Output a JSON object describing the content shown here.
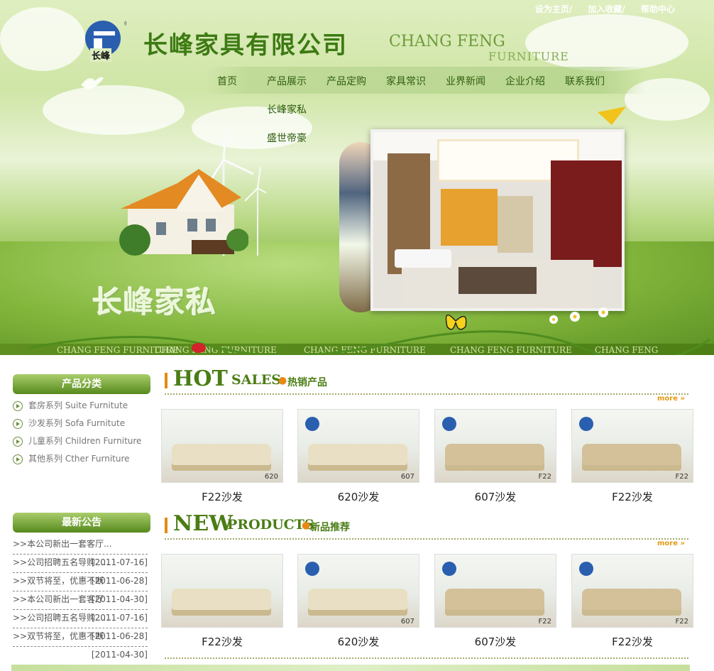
{
  "top_links": [
    "设为主页/",
    "加入收藏/",
    "帮助中心"
  ],
  "logo_text": "长峰",
  "company_name": "长峰家具有限公司",
  "english_name_1": "CHANG FENG",
  "english_name_2": "FURNITURE",
  "nav": [
    "首页",
    "产品展示",
    "产品定购",
    "家具常识",
    "业界新闻",
    "企业介绍",
    "联系我们"
  ],
  "nav_dropdown": [
    "长峰家私",
    "盛世帝豪"
  ],
  "banner_slogan": "长峰家私",
  "strip_texts": [
    "CHANG FENG FURNITURE",
    "CHANG FENG FURNITURE",
    "CHANG FENG FURNITURE",
    "CHANG FENG FURNITURE",
    "CHANG FENG FURNITURE"
  ],
  "categories": {
    "title": "产品分类",
    "items": [
      "套房系列 Suite Furnitute",
      "沙发系列 Sofa Furnitute",
      "儿童系列 Children Furniture",
      "其他系列 Cther Furniture"
    ]
  },
  "notices": {
    "title": "最新公告",
    "items": [
      {
        "text": ">>本公司新出一套客厅...",
        "date": ""
      },
      {
        "text": ">>公司招聘五名导购......",
        "date": "[2011-07-16]"
      },
      {
        "text": ">>双节将至，优惠不断",
        "date": "[2011-06-28]"
      },
      {
        "text": ">>本公司新出一套客厅",
        "date": "[2011-04-30]"
      },
      {
        "text": ">>公司招聘五名导购......",
        "date": "[2011-07-16]"
      },
      {
        "text": ">>双节将至，优惠不断",
        "date": "[2011-06-28]"
      },
      {
        "text": "",
        "date": "[2011-04-30]"
      }
    ]
  },
  "hot": {
    "big": "HOT",
    "mid": "SALES",
    "cn": "热销产品",
    "more": "more",
    "products": [
      {
        "name": "F22沙发",
        "tag": "620"
      },
      {
        "name": "620沙发",
        "tag": "607"
      },
      {
        "name": "607沙发",
        "tag": "F22"
      },
      {
        "name": "F22沙发",
        "tag": "F22"
      }
    ]
  },
  "new": {
    "big": "NEW",
    "mid": "PRODUCTS",
    "cn": "新品推荐",
    "more": "more",
    "products": [
      {
        "name": "F22沙发",
        "tag": ""
      },
      {
        "name": "620沙发",
        "tag": "607"
      },
      {
        "name": "607沙发",
        "tag": "F22"
      },
      {
        "name": "F22沙发",
        "tag": "F22"
      }
    ]
  },
  "colors": {
    "brand_green": "#4a7d14",
    "accent_orange": "#e58a12",
    "logo_blue": "#2a5fb0"
  }
}
